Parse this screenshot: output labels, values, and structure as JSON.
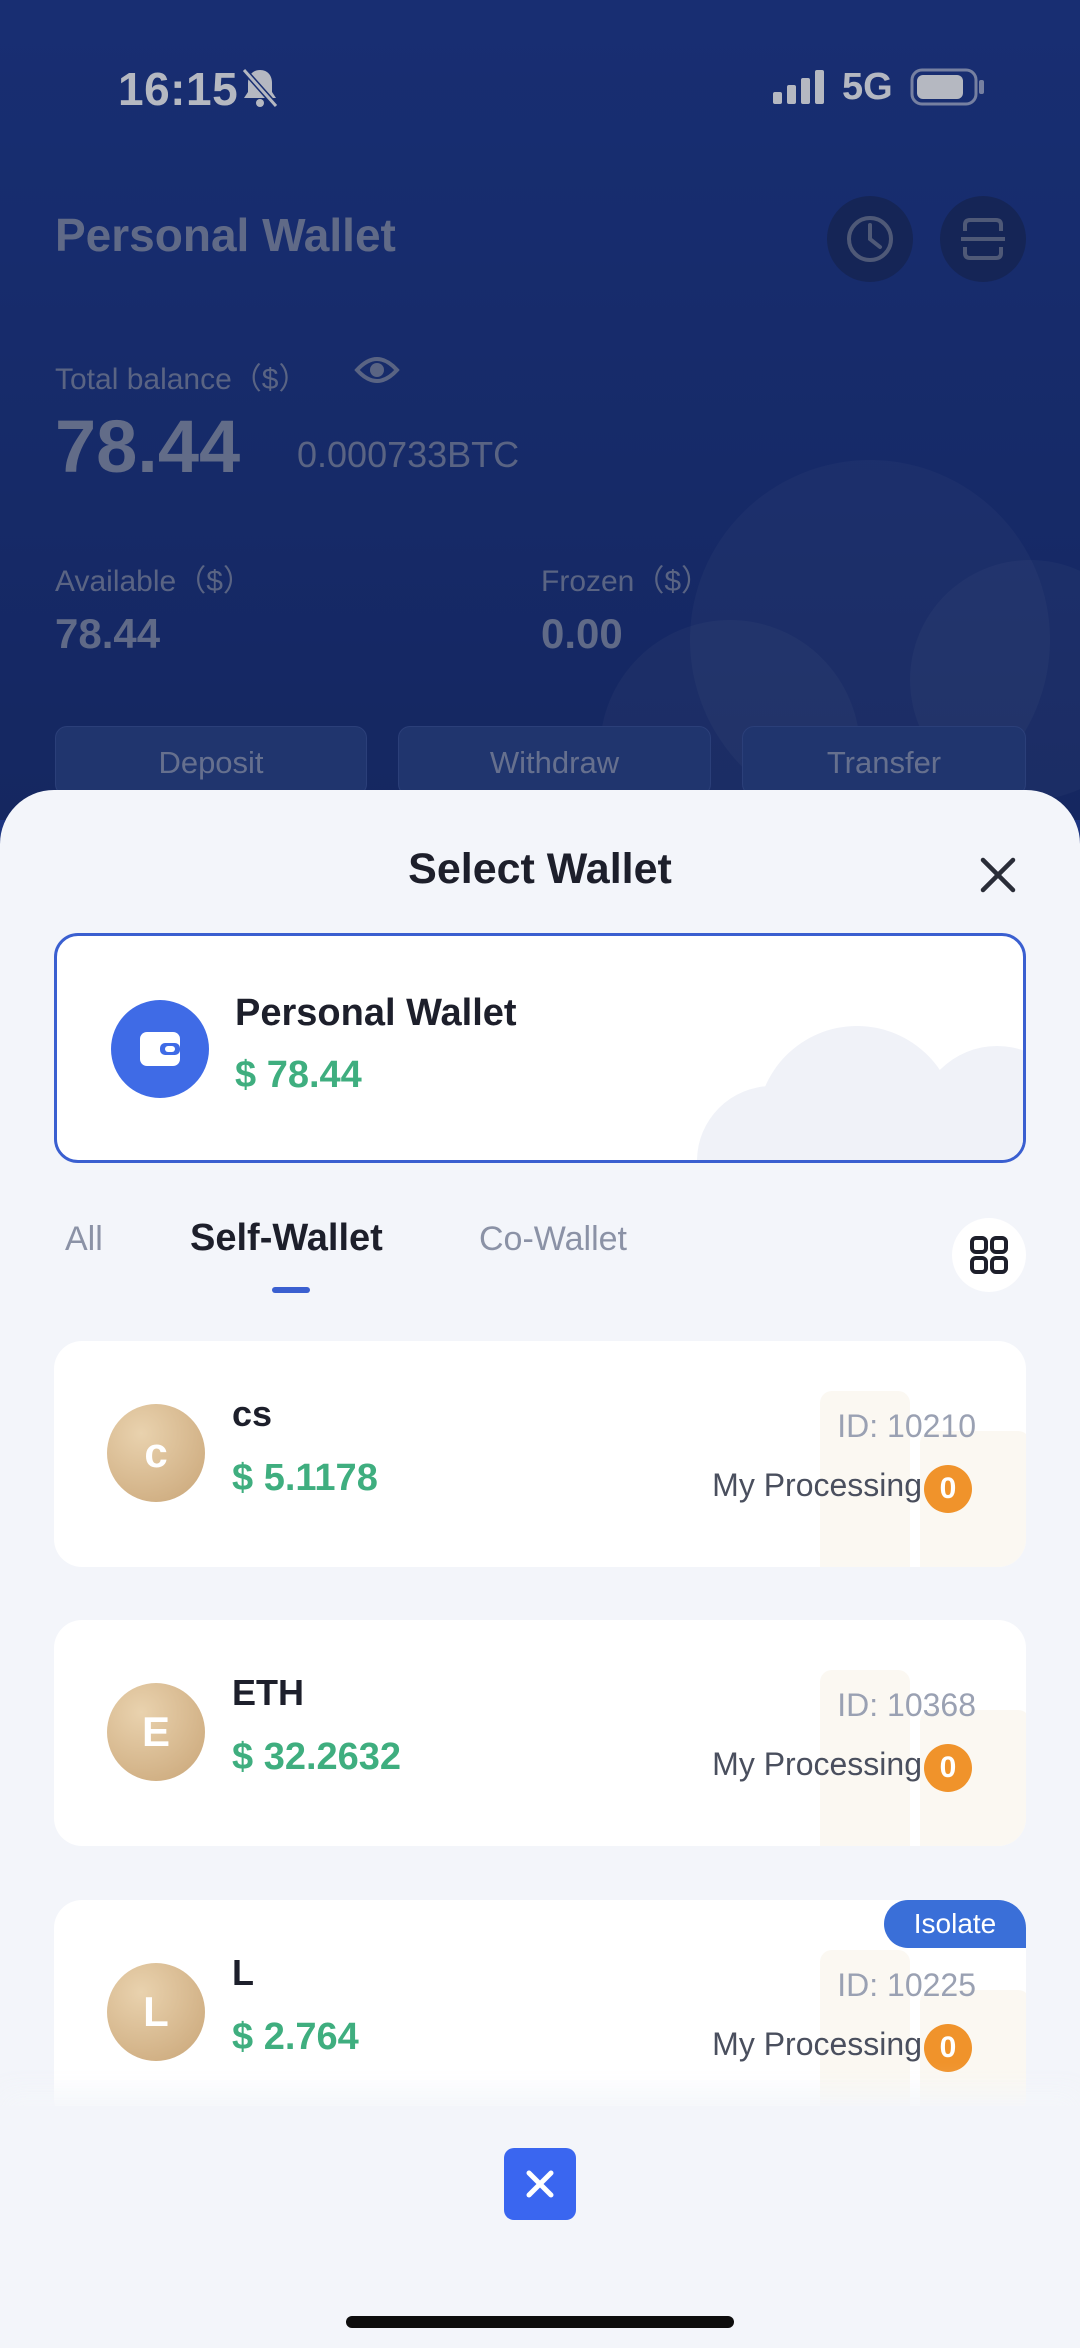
{
  "status_bar": {
    "time": "16:15",
    "network": "5G",
    "icons": [
      "bell-off-icon",
      "signal-icon",
      "battery-icon"
    ]
  },
  "background": {
    "title": "Personal Wallet",
    "header_icons": [
      "history-icon",
      "scan-icon"
    ],
    "total_balance_label": "Total balance（$）",
    "total_balance": "78.44",
    "total_btc": "0.000733BTC",
    "available_label": "Available（$）",
    "available": "78.44",
    "frozen_label": "Frozen（$）",
    "frozen": "0.00",
    "buttons": [
      "Deposit",
      "Withdraw",
      "Transfer"
    ]
  },
  "sheet": {
    "title": "Select Wallet",
    "current": {
      "name": "Personal Wallet",
      "amount": "$ 78.44",
      "icon": "wallet-icon"
    },
    "tabs": [
      "All",
      "Self-Wallet",
      "Co-Wallet"
    ],
    "active_tab": "Self-Wallet",
    "wallets": [
      {
        "initial": "c",
        "name": "cs",
        "amount": "$ 5.1178",
        "id": "ID: 10210",
        "processing_label": "My Processing",
        "processing_count": "0"
      },
      {
        "initial": "E",
        "name": "ETH",
        "amount": "$ 32.2632",
        "id": "ID: 10368",
        "processing_label": "My Processing",
        "processing_count": "0"
      },
      {
        "initial": "L",
        "name": "L",
        "amount": "$ 2.764",
        "id": "ID: 10225",
        "processing_label": "My Processing",
        "processing_count": "0",
        "tag": "Isolate"
      }
    ]
  },
  "colors": {
    "accent": "#3a5fd0",
    "amount_green": "#3fae7f",
    "badge_orange": "#f0932b",
    "header_blue": "#1f3a8f"
  }
}
